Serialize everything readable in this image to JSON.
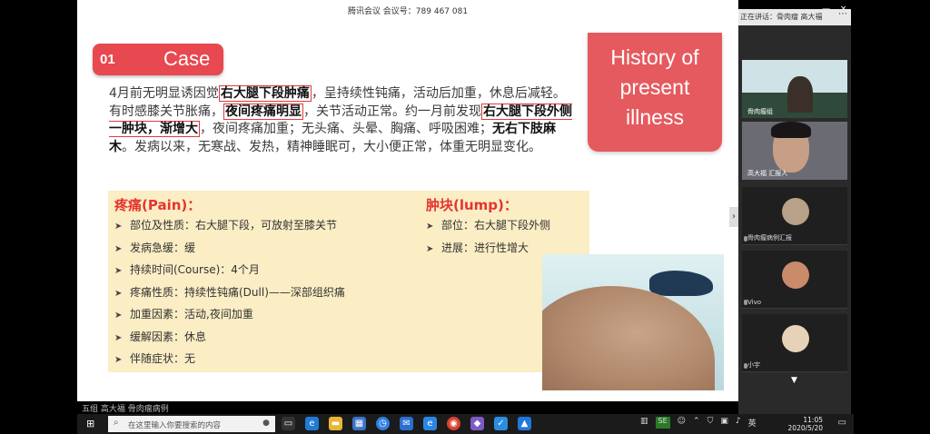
{
  "meeting": {
    "id_text": "腾讯会议 会议号：789 467 081"
  },
  "window_controls": "— ×",
  "slide": {
    "case_number": "01",
    "case_label": "Case",
    "hpi_lines": [
      "History of",
      "present",
      "illness"
    ],
    "history": {
      "p1": "4月前无明显诱因觉",
      "hl1": "右大腿下段肿痛",
      "p2": "，呈持续性钝痛，活动后加重，休息后减轻。有时感膝关节胀痛，",
      "hl2": "夜间疼痛明显",
      "p3": "，关节活动正常。约一月前发现",
      "hl3": "右大腿下段外侧一肿块，渐增大",
      "p4": "，夜间疼痛加重；无头痛、头晕、胸痛、呼吸困难；",
      "b4": "无右下肢麻木",
      "p5": "。发病以来，无寒战、发热，精神睡眠可，大小便正常，体重无明显变化。"
    },
    "pain": {
      "title": "疼痛(Pain)：",
      "items": [
        "部位及性质：右大腿下段，可放射至膝关节",
        "发病急缓：缓",
        "持续时间(Course)：4个月",
        "疼痛性质：持续性钝痛(Dull)——深部组织痛",
        "加重因素：活动,夜间加重",
        "缓解因素：休息",
        "伴随症状：无"
      ]
    },
    "lump": {
      "title": "肿块(lump)：",
      "items": [
        "部位：右大腿下段外侧",
        "进展：进行性增大"
      ]
    },
    "bullet_glyph": "➤"
  },
  "slide_footer": "五组 高大福 骨肉瘤病例",
  "sidebar": {
    "header": "正在讲话：骨肉瘤 高大福",
    "tiles": [
      {
        "name": "骨肉瘤病例汇报"
      },
      {
        "name": "Vivo"
      },
      {
        "name": "小宇"
      }
    ],
    "video1_name": "骨肉瘤组",
    "video2_name": "高大福 汇报人",
    "scroll_glyph": "▼"
  },
  "taskbar": {
    "search_placeholder": "在这里输入你要搜索的内容",
    "tray_badge": "SE",
    "time": "11:05",
    "date": "2020/5/20"
  },
  "colors": {
    "accent_red": "#e8484f",
    "panel_yellow": "#fbedc4",
    "highlight_border": "#e23a3a"
  }
}
